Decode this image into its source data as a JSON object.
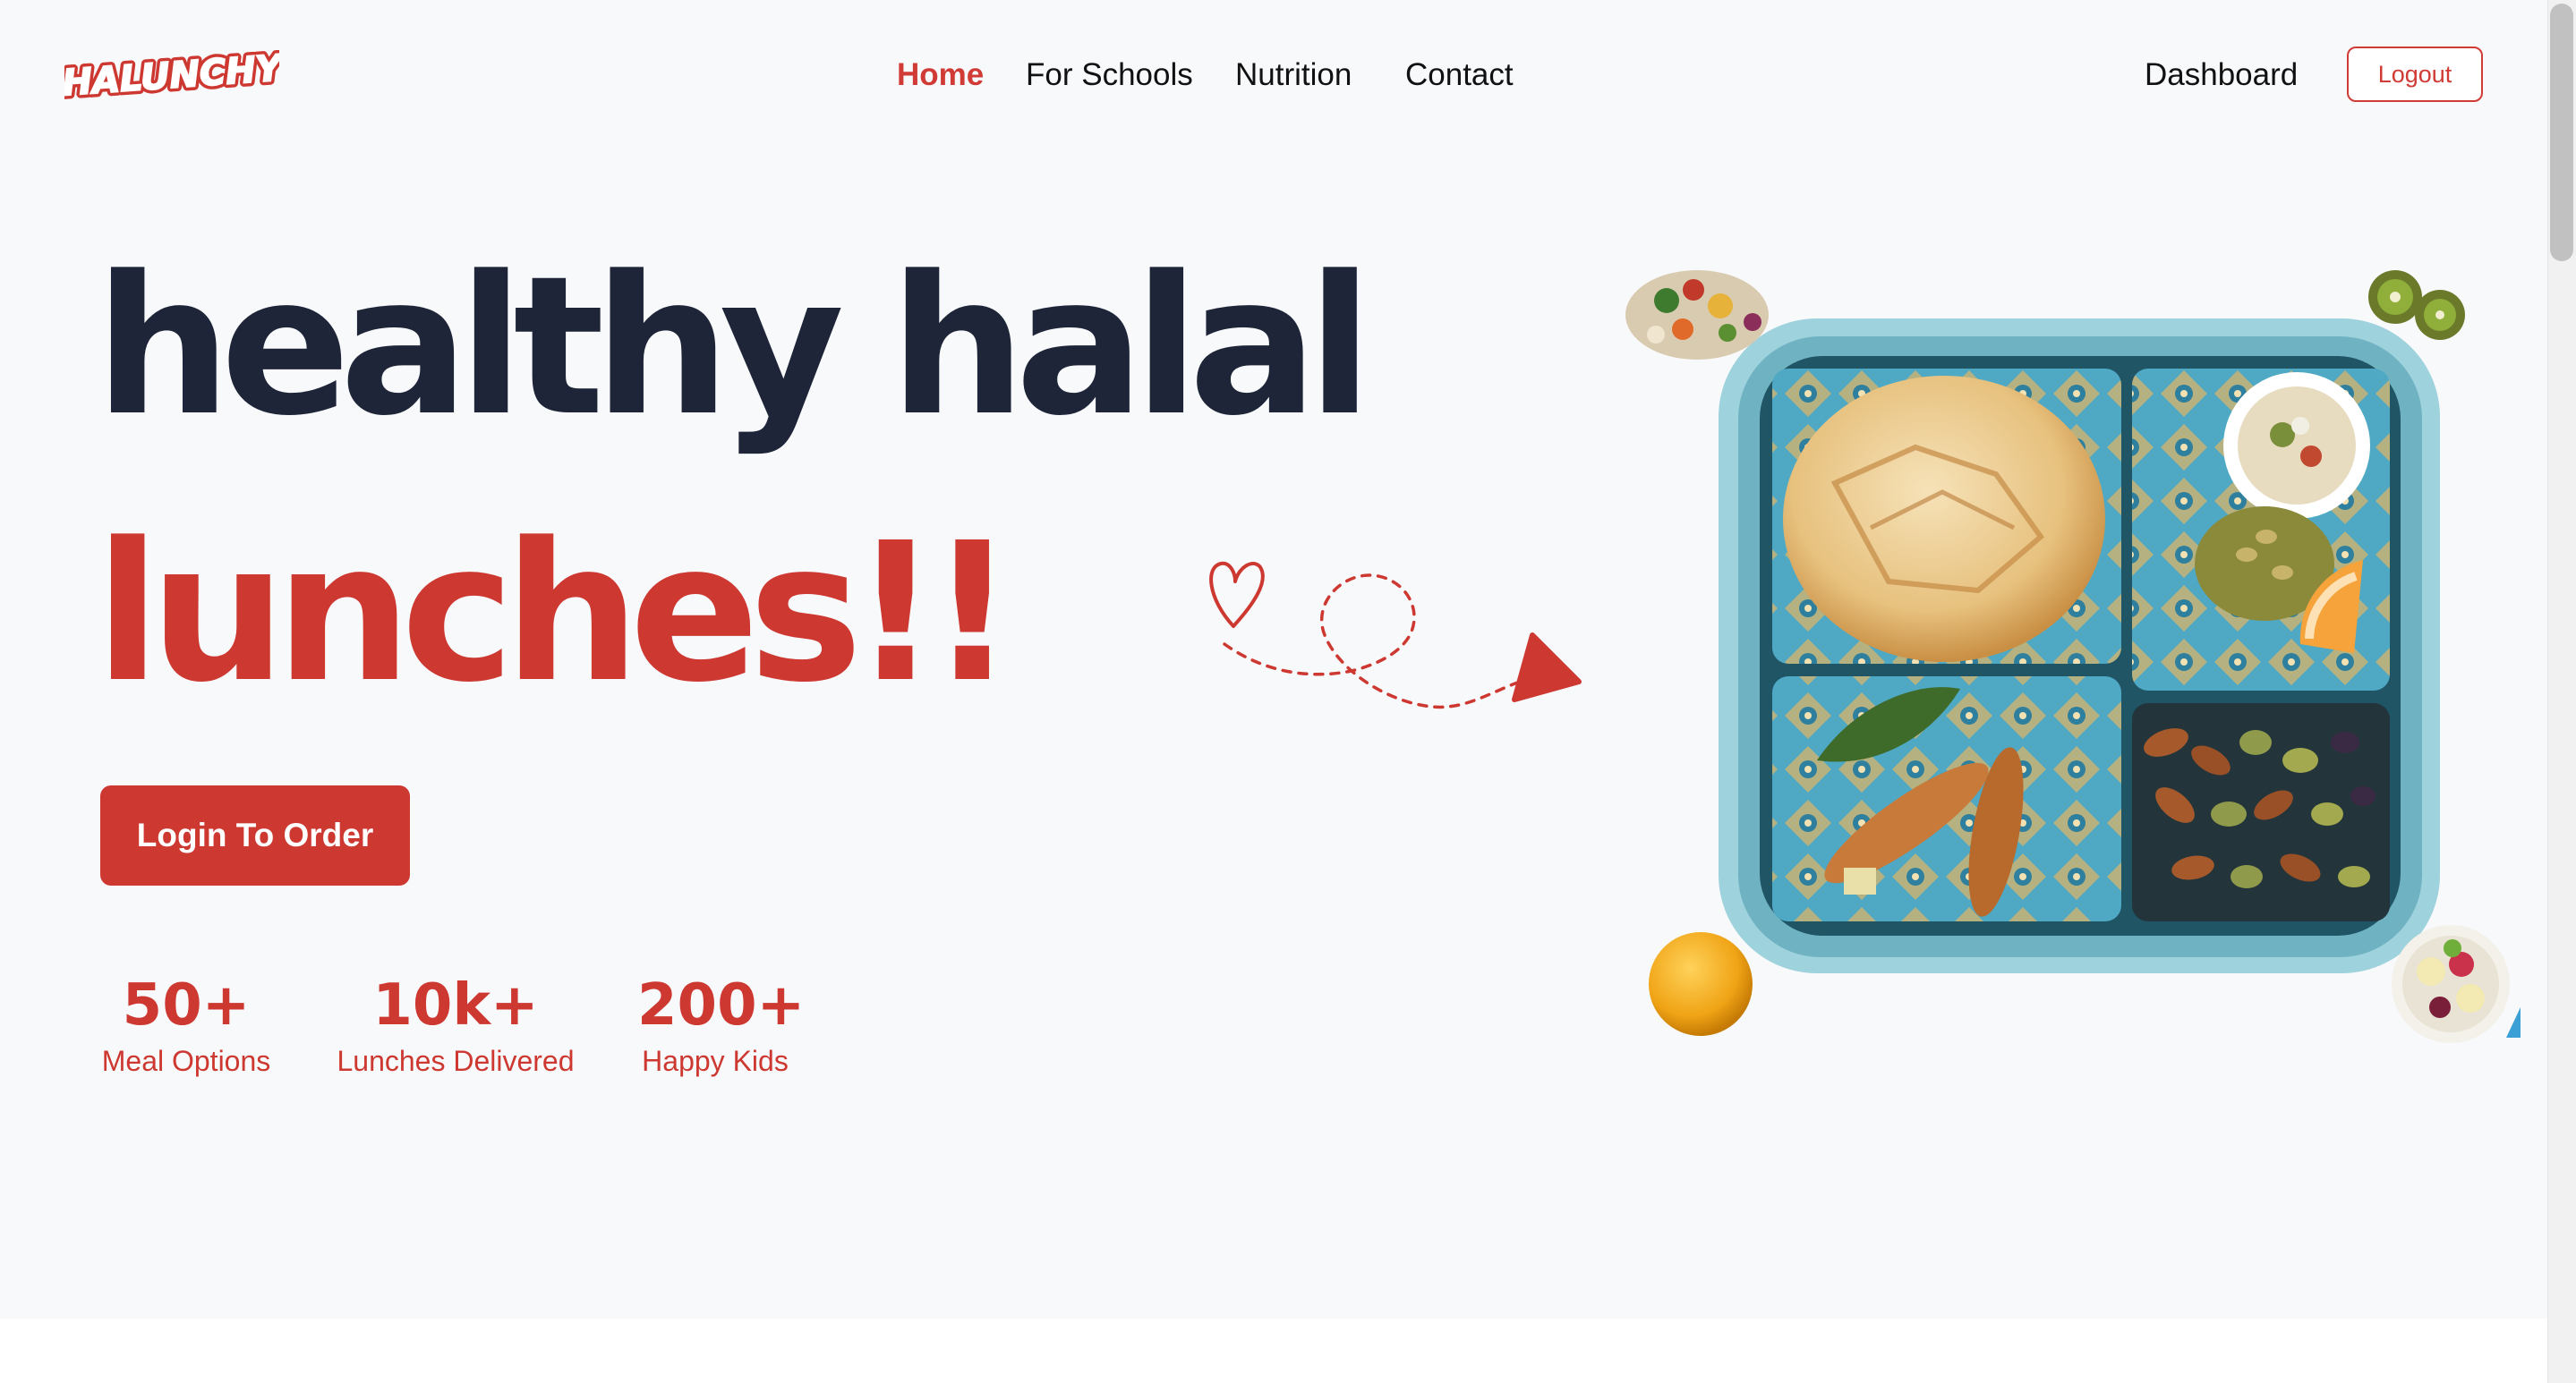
{
  "brand": {
    "logo_text": "HALUNCHY",
    "accent_color": "#cd3831",
    "dark_color": "#1e2538"
  },
  "nav": {
    "links": [
      {
        "label": "Home",
        "active": true
      },
      {
        "label": "For Schools",
        "active": false
      },
      {
        "label": "Nutrition",
        "active": false
      },
      {
        "label": "Contact",
        "active": false
      }
    ],
    "dashboard_label": "Dashboard",
    "logout_label": "Logout"
  },
  "hero": {
    "title_line1": "healthy halal",
    "title_line2": "lunches!!",
    "cta_label": "Login To Order",
    "doodle_icons": [
      "heart-icon",
      "dashed-loop-arrow"
    ],
    "image_description_icons": [
      "lunchbox-image",
      "veggie-bowl-image",
      "kiwi-image",
      "orange-image",
      "fruit-bowl-image"
    ]
  },
  "stats": [
    {
      "value": "50+",
      "label": "Meal Options"
    },
    {
      "value": "10k+",
      "label": "Lunches Delivered"
    },
    {
      "value": "200+",
      "label": "Happy Kids"
    }
  ]
}
